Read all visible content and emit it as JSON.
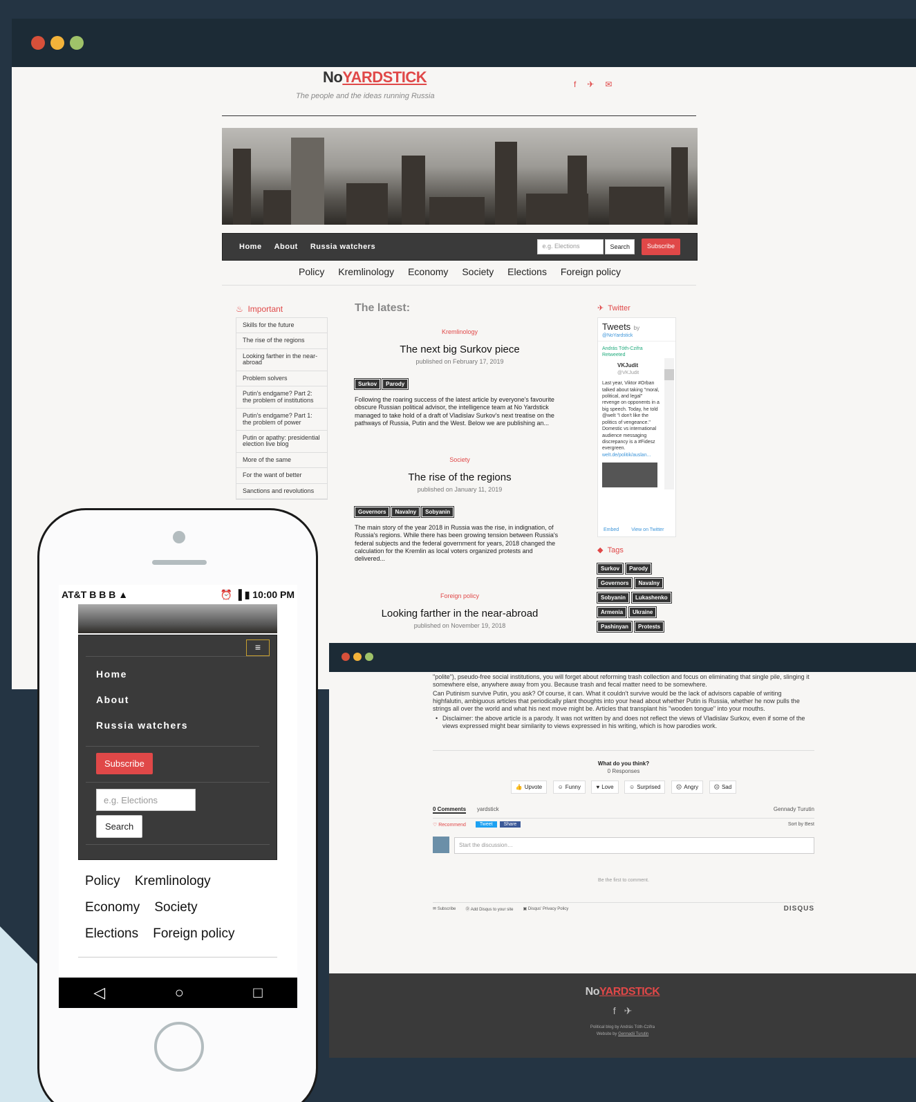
{
  "site": {
    "logo_no": "No",
    "logo_yardstick": "YARDSTICK",
    "tagline": "The people and the ideas running Russia"
  },
  "nav": {
    "links": [
      "Home",
      "About",
      "Russia watchers"
    ],
    "search_placeholder": "e.g. Elections",
    "search_label": "Search",
    "subscribe_label": "Subscribe"
  },
  "categories": [
    "Policy",
    "Kremlinology",
    "Economy",
    "Society",
    "Elections",
    "Foreign policy"
  ],
  "sidebar": {
    "title": "Important",
    "items": [
      "Skills for the future",
      "The rise of the regions",
      "Looking farther in the near-abroad",
      "Problem solvers",
      "Putin's endgame? Part 2: the problem of institutions",
      "Putin's endgame? Part 1: the problem of power",
      "Putin or apathy: presidential election live blog",
      "More of the same",
      "For the want of better",
      "Sanctions and revolutions"
    ]
  },
  "latest_heading": "The latest:",
  "articles": [
    {
      "category": "Kremlinology",
      "title": "The next big Surkov piece",
      "published": "published on February 17, 2019",
      "tags": [
        "Surkov",
        "Parody"
      ],
      "excerpt": "Following the roaring success of the latest article by everyone's favourite obscure Russian political advisor, the intelligence team at No Yardstick managed to take hold of a draft of Vladislav Surkov's next treatise on the pathways of Russia, Putin and the West. Below we are publishing an..."
    },
    {
      "category": "Society",
      "title": "The rise of the regions",
      "published": "published on January 11, 2019",
      "tags": [
        "Governors",
        "Navalny",
        "Sobyanin"
      ],
      "excerpt": "The main story of the year 2018 in Russia was the rise, in indignation, of Russia's regions. While there has been growing tension between Russia's federal subjects and the federal government for years, 2018 changed the calculation for the Kremlin as local voters organized protests and delivered..."
    },
    {
      "category": "Foreign policy",
      "title": "Looking farther in the near-abroad",
      "published": "published on November 19, 2018"
    }
  ],
  "twitter": {
    "title": "Twitter",
    "header": "Tweets",
    "by": "by",
    "handle": "@NoYardstick",
    "retweet": "András Tóth-Czifra Retweeted",
    "user": "VKJudit",
    "user_handle": "@VKJudit",
    "tweet": "Last year, Viktor #Orban talked about taking \"moral, political, and legal\" revenge on opponents in a big speech. Today, he told @welt \"I don't like the politics of vengeance.\" Domestic vs international audience messaging discrepancy is a #Fidesz evergreen.",
    "link": "welt.de/politik/auslan...",
    "embed": "Embed",
    "view": "View on Twitter"
  },
  "tags_section": {
    "title": "Tags",
    "tags": [
      "Surkov",
      "Parody",
      "Governors",
      "Navalny",
      "Sobyanin",
      "Lukashenko",
      "Armenia",
      "Ukraine",
      "Pashinyan",
      "Protests"
    ]
  },
  "article_page": {
    "para1": "\"polite\"), pseudo-free social institutions, you will forget about reforming trash collection and focus on eliminating that single pile, slinging it somewhere else, anywhere away from you. Because trash and fecal matter need to be somewhere.",
    "para2": "Can Putinism survive Putin, you ask? Of course, it can. What it couldn't survive would be the lack of advisors capable of writing highfalutin, ambiguous articles that periodically plant thoughts into your head about whether Putin is Russia, whether he now pulls the strings all over the world and what his next move might be. Articles that transplant his \"wooden tongue\" into your mouths.",
    "disclaimer": "Disclaimer: the above article is a parody. It was not written by and does not reflect the views of Vladislav Surkov, even if some of the views expressed might bear similarity to views expressed in his writing, which is how parodies work."
  },
  "disqus": {
    "question": "What do you think?",
    "responses": "0 Responses",
    "reactions": [
      "Upvote",
      "Funny",
      "Love",
      "Surprised",
      "Angry",
      "Sad"
    ],
    "comments_tab": "0 Comments",
    "site_tab": "yardstick",
    "user": "Gennady Turutin",
    "recommend": "Recommend",
    "tweet": "Tweet",
    "share": "Share",
    "sort": "Sort by Best",
    "placeholder": "Start the discussion…",
    "empty": "Be the first to comment.",
    "subscribe": "Subscribe",
    "add": "Add Disqus to your site",
    "privacy": "Disqus' Privacy Policy",
    "brand": "DISQUS"
  },
  "footer": {
    "credit1": "Political blog by András Tóth-Czifra",
    "credit2_prefix": "Website by",
    "credit2_name": "Gennadii Turutin"
  },
  "phone": {
    "carrier": "AT&T",
    "status_icons": "B B B",
    "time": "10:00 PM",
    "nav": [
      "Home",
      "About",
      "Russia watchers"
    ],
    "subscribe": "Subscribe",
    "search_placeholder": "e.g. Elections",
    "search": "Search",
    "categories": [
      [
        "Policy",
        "Kremlinology"
      ],
      [
        "Economy",
        "Society"
      ],
      [
        "Elections",
        "Foreign policy"
      ]
    ]
  },
  "colors": {
    "accent": "#e04848",
    "dark": "#1c2b36",
    "nav": "#3a3a3a"
  }
}
